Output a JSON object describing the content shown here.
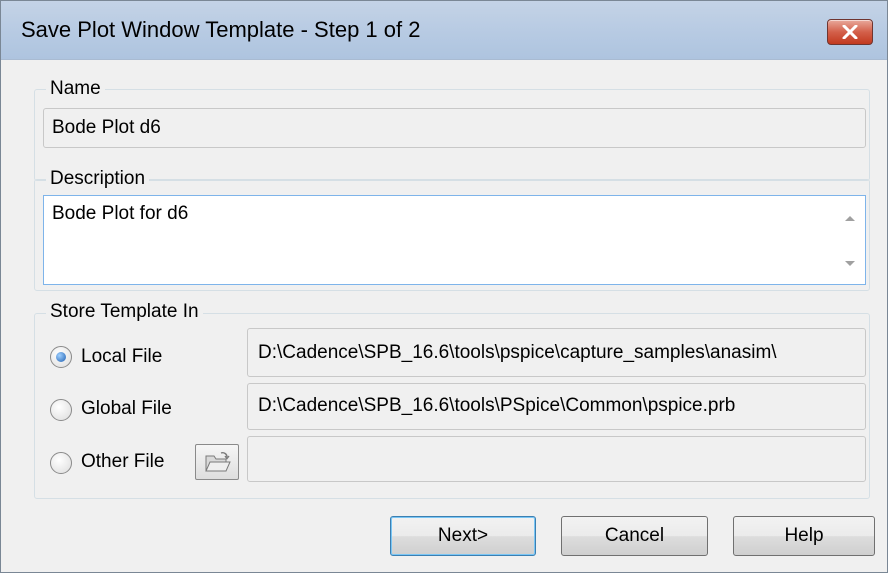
{
  "window": {
    "title": "Save Plot Window Template - Step 1 of 2"
  },
  "name_group": {
    "label": "Name",
    "value": "Bode Plot d6"
  },
  "description_group": {
    "label": "Description",
    "value": "Bode Plot for d6"
  },
  "store_group": {
    "label": "Store Template In",
    "options": [
      {
        "label": "Local File",
        "selected": true,
        "path": "D:\\Cadence\\SPB_16.6\\tools\\pspice\\capture_samples\\anasim\\"
      },
      {
        "label": "Global File",
        "selected": false,
        "path": "D:\\Cadence\\SPB_16.6\\tools\\PSpice\\Common\\pspice.prb"
      },
      {
        "label": "Other File",
        "selected": false,
        "path": ""
      }
    ]
  },
  "buttons": {
    "next": "Next>",
    "cancel": "Cancel",
    "help": "Help"
  },
  "icons": {
    "close": "close-icon",
    "browse": "folder-open-icon",
    "scroll_up": "scroll-up-arrow-icon",
    "scroll_down": "scroll-down-arrow-icon"
  },
  "colors": {
    "titlebar": "#b8cbe3",
    "close_button": "#d3604a",
    "radio_selected": "#1f5fb0",
    "dialog_background": "#f0f0f0"
  }
}
